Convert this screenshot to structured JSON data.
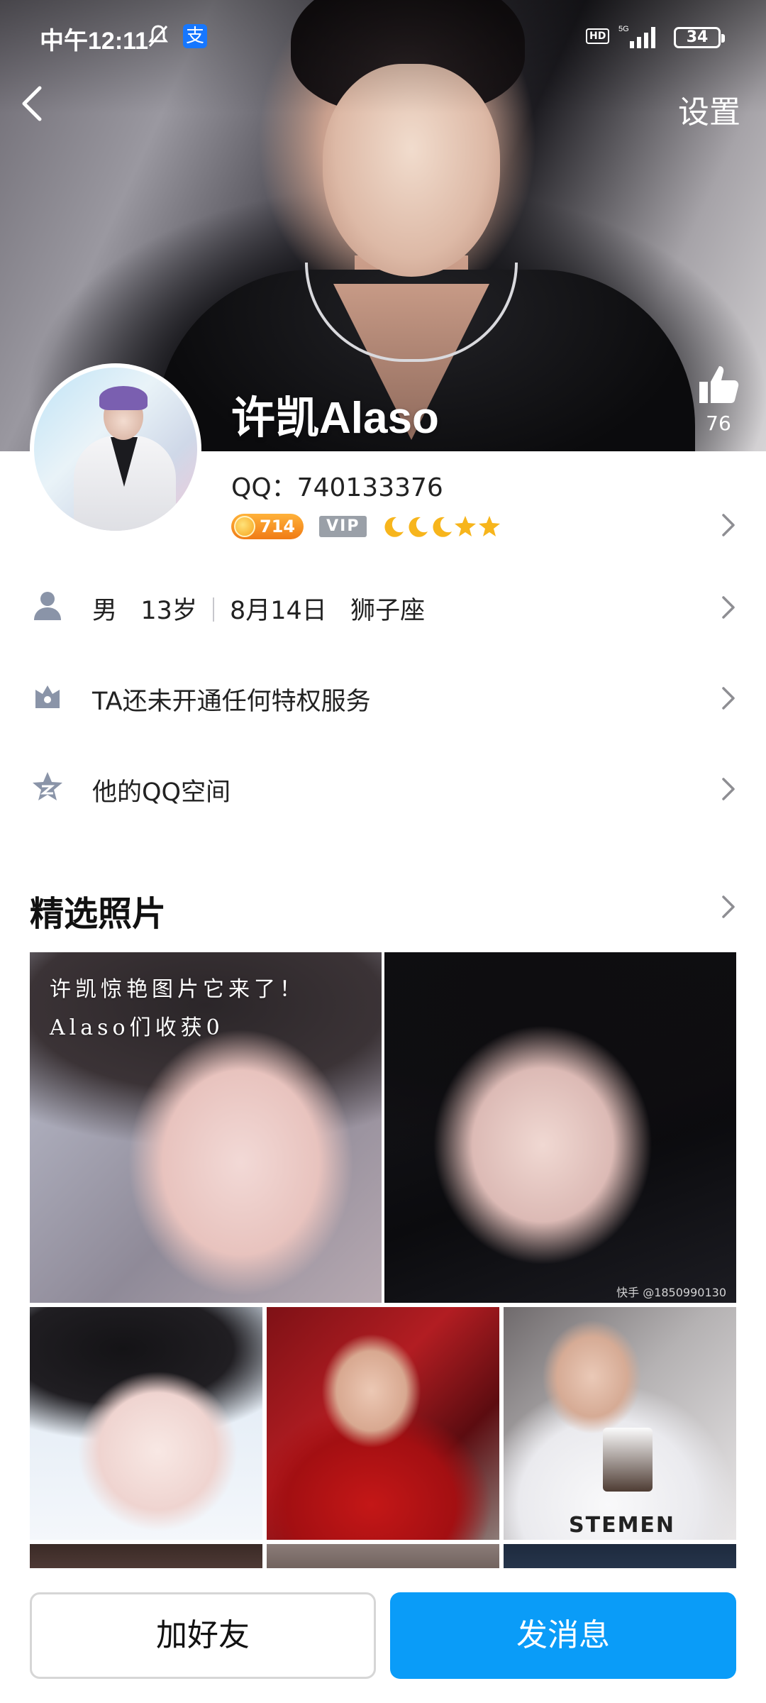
{
  "status_bar": {
    "time": "中午12:11",
    "network": "5G",
    "hd_label": "HD",
    "battery": "34"
  },
  "nav": {
    "settings_label": "设置"
  },
  "profile": {
    "name": "许凯Alaso",
    "qq": "QQ：740133376",
    "like_count": "76",
    "level": "714",
    "vip_label": "VIP"
  },
  "info_rows": {
    "gender": "男",
    "age": "13岁",
    "birthday": "8月14日",
    "zodiac": "狮子座",
    "privilege": "TA还未开通任何特权服务",
    "qzone": "他的QQ空间"
  },
  "photos": {
    "title": "精选照片",
    "caption_line1": "许凯惊艳图片它来了！",
    "caption_line2": "Alaso们收获0",
    "watermark": "快手 @1850990130",
    "shirt_text": "STEMEN"
  },
  "actions": {
    "add_friend": "加好友",
    "send_message": "发消息"
  },
  "colors": {
    "accent": "#0a9cf8",
    "level_badge": "#f07b16",
    "vip_badge": "#9aa0a8",
    "star": "#f7b51c"
  }
}
